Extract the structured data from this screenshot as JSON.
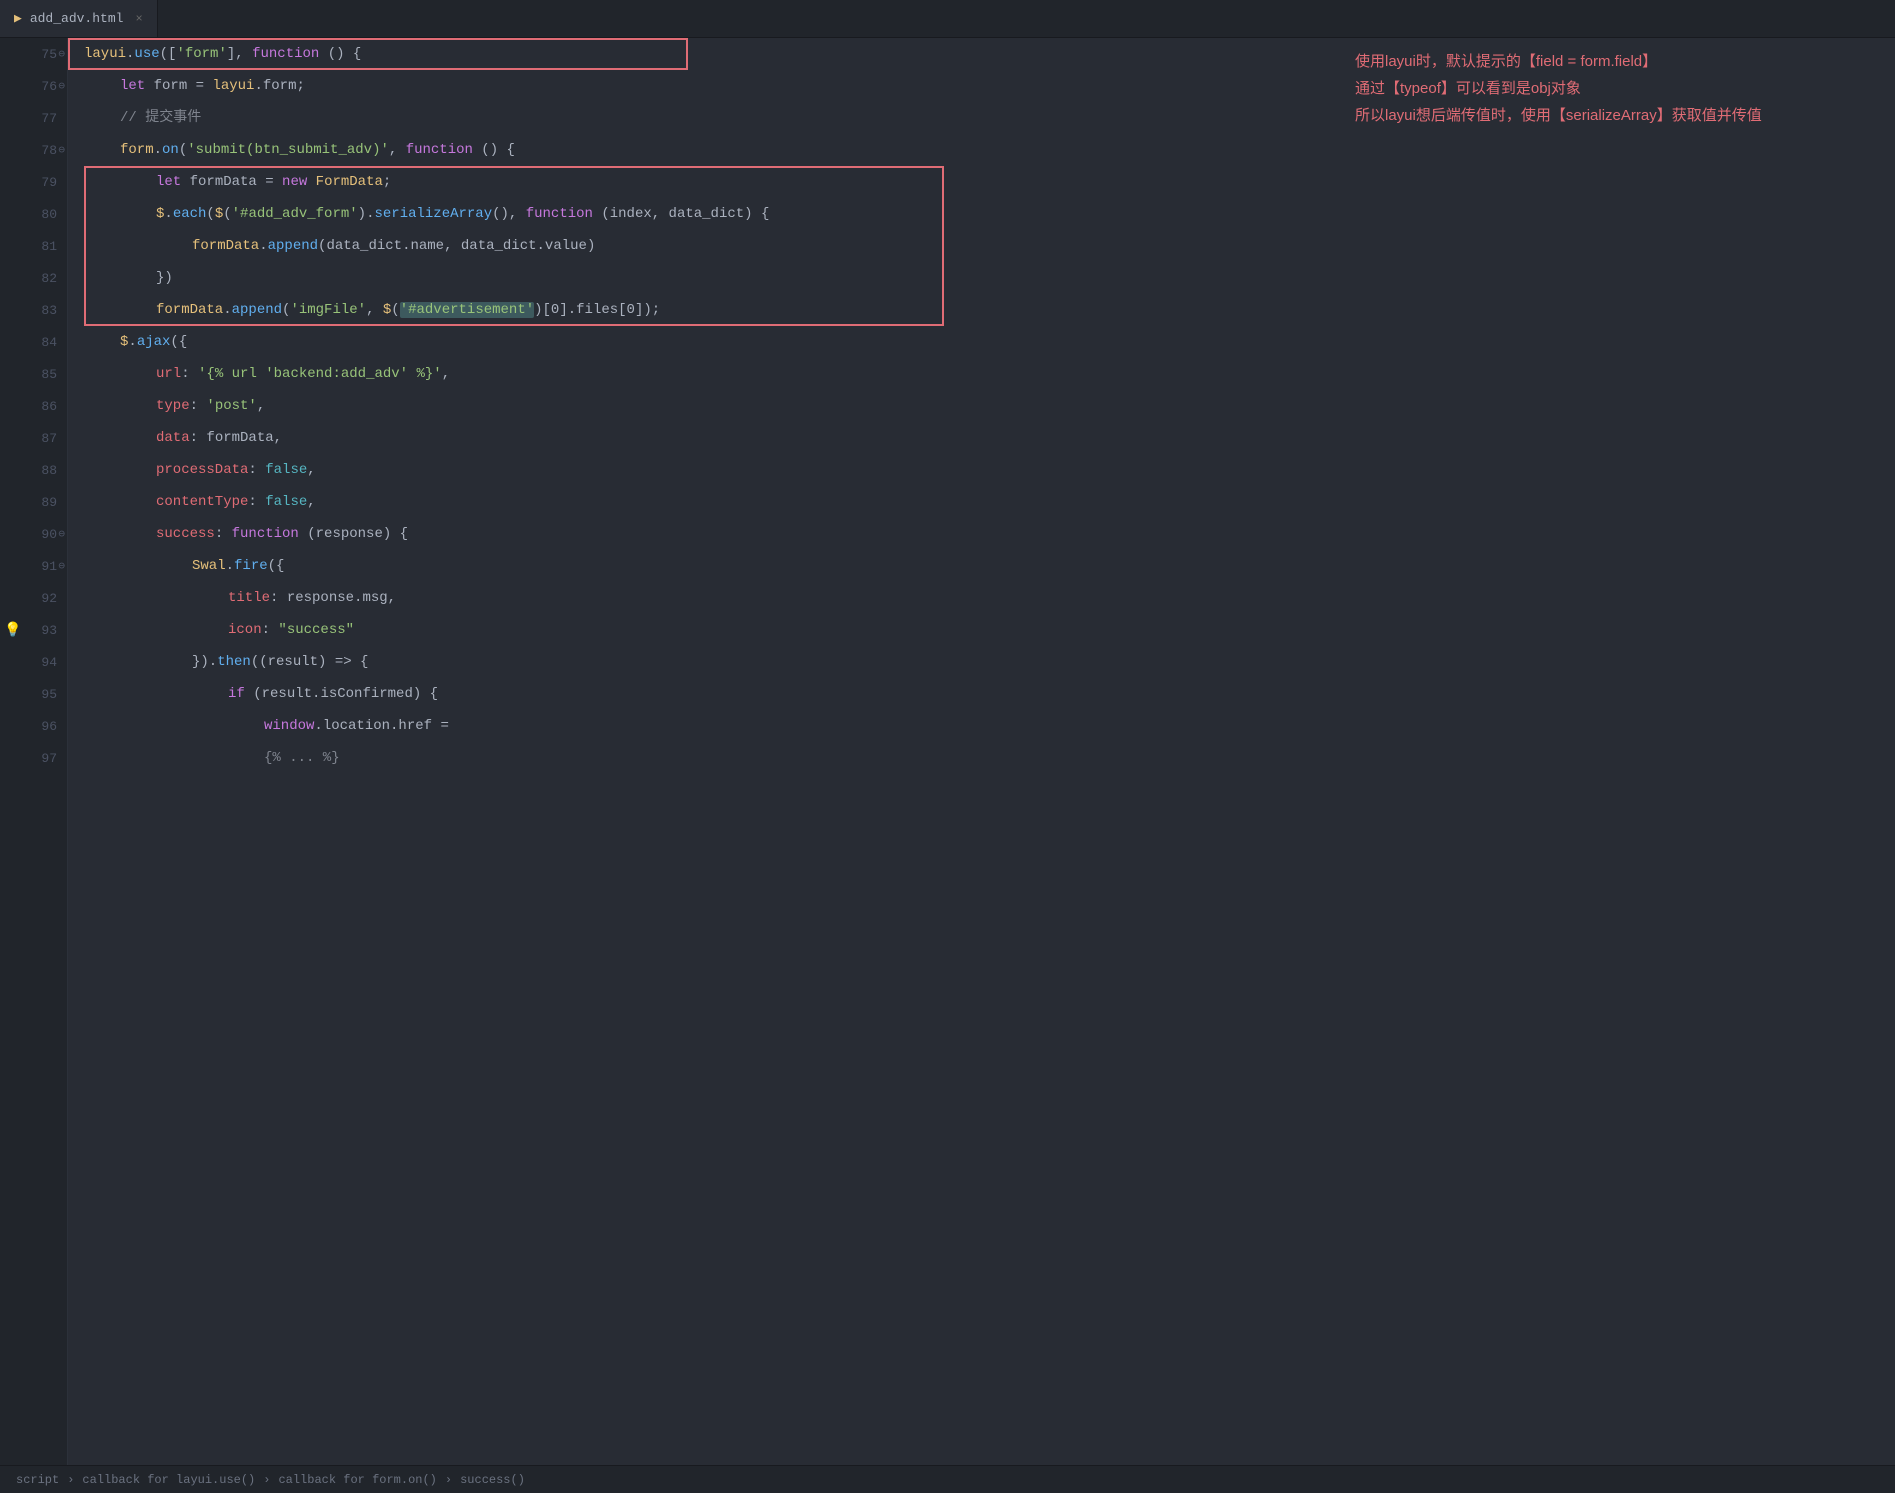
{
  "tab": {
    "icon": "{}",
    "filename": "add_adv.html",
    "close": "×"
  },
  "comment": {
    "line1": "使用layui时，默认提示的【field = form.field】",
    "line2": "通过【typeof】可以看到是obj对象",
    "line3": "所以layui想后端传值时，使用【serializeArray】获取值并传值"
  },
  "lines": [
    {
      "num": "75",
      "indent": 0,
      "tokens": [
        {
          "text": "layui",
          "cls": "kw-yellow"
        },
        {
          "text": ".",
          "cls": "kw-white"
        },
        {
          "text": "use",
          "cls": "kw-blue"
        },
        {
          "text": "([",
          "cls": "kw-white"
        },
        {
          "text": "'form'",
          "cls": "kw-green"
        },
        {
          "text": "], ",
          "cls": "kw-white"
        },
        {
          "text": "function",
          "cls": "kw-purple"
        },
        {
          "text": " () {",
          "cls": "kw-white"
        }
      ],
      "redbox": "outer",
      "hasFold": true
    },
    {
      "num": "76",
      "indent": 1,
      "tokens": [
        {
          "text": "let",
          "cls": "kw-purple"
        },
        {
          "text": " form = ",
          "cls": "kw-white"
        },
        {
          "text": "layui",
          "cls": "kw-yellow"
        },
        {
          "text": ".",
          "cls": "kw-white"
        },
        {
          "text": "form",
          "cls": "kw-white"
        },
        {
          "text": ";",
          "cls": "kw-white"
        }
      ],
      "hasFold": true
    },
    {
      "num": "77",
      "indent": 1,
      "tokens": [
        {
          "text": "// 提交事件",
          "cls": "kw-comment"
        }
      ]
    },
    {
      "num": "78",
      "indent": 1,
      "tokens": [
        {
          "text": "form",
          "cls": "kw-yellow"
        },
        {
          "text": ".",
          "cls": "kw-white"
        },
        {
          "text": "on",
          "cls": "kw-blue"
        },
        {
          "text": "(",
          "cls": "kw-white"
        },
        {
          "text": "'submit(btn_submit_adv)'",
          "cls": "kw-green"
        },
        {
          "text": ", ",
          "cls": "kw-white"
        },
        {
          "text": "function",
          "cls": "kw-purple"
        },
        {
          "text": " () {",
          "cls": "kw-white"
        }
      ],
      "hasFold": true
    },
    {
      "num": "79",
      "indent": 2,
      "tokens": [
        {
          "text": "let",
          "cls": "kw-purple"
        },
        {
          "text": " formData = ",
          "cls": "kw-white"
        },
        {
          "text": "new",
          "cls": "kw-purple"
        },
        {
          "text": " FormData",
          "cls": "kw-yellow"
        },
        {
          "text": ";",
          "cls": "kw-white"
        }
      ],
      "redbox": "inner-start"
    },
    {
      "num": "80",
      "indent": 2,
      "tokens": [
        {
          "text": "$",
          "cls": "kw-yellow"
        },
        {
          "text": ".",
          "cls": "kw-white"
        },
        {
          "text": "each",
          "cls": "kw-blue"
        },
        {
          "text": "(",
          "cls": "kw-white"
        },
        {
          "text": "$",
          "cls": "kw-yellow"
        },
        {
          "text": "(",
          "cls": "kw-white"
        },
        {
          "text": "'#add_adv_form'",
          "cls": "kw-green"
        },
        {
          "text": ").",
          "cls": "kw-white"
        },
        {
          "text": "serializeArray",
          "cls": "kw-blue"
        },
        {
          "text": "(), ",
          "cls": "kw-white"
        },
        {
          "text": "function",
          "cls": "kw-purple"
        },
        {
          "text": " (index, data_dict) {",
          "cls": "kw-white"
        }
      ]
    },
    {
      "num": "81",
      "indent": 3,
      "tokens": [
        {
          "text": "formData",
          "cls": "kw-yellow"
        },
        {
          "text": ".",
          "cls": "kw-white"
        },
        {
          "text": "append",
          "cls": "kw-blue"
        },
        {
          "text": "(",
          "cls": "kw-white"
        },
        {
          "text": "data_dict",
          "cls": "kw-white"
        },
        {
          "text": ".name, ",
          "cls": "kw-white"
        },
        {
          "text": "data_dict",
          "cls": "kw-white"
        },
        {
          "text": ".value",
          "cls": "kw-white"
        },
        {
          "text": ")",
          "cls": "kw-white"
        }
      ]
    },
    {
      "num": "82",
      "indent": 2,
      "tokens": [
        {
          "text": "})",
          "cls": "kw-white"
        }
      ]
    },
    {
      "num": "83",
      "indent": 2,
      "tokens": [
        {
          "text": "formData",
          "cls": "kw-yellow"
        },
        {
          "text": ".",
          "cls": "kw-white"
        },
        {
          "text": "append",
          "cls": "kw-blue"
        },
        {
          "text": "(",
          "cls": "kw-white"
        },
        {
          "text": "'imgFile'",
          "cls": "kw-green"
        },
        {
          "text": ", ",
          "cls": "kw-white"
        },
        {
          "text": "$",
          "cls": "kw-yellow"
        },
        {
          "text": "(",
          "cls": "kw-white"
        },
        {
          "text": "'#advertisement'",
          "cls": "kw-green",
          "highlight": true
        },
        {
          "text": ")[0].",
          "cls": "kw-white"
        },
        {
          "text": "files",
          "cls": "kw-white"
        },
        {
          "text": "[0]",
          "cls": "kw-white"
        },
        {
          "text": ");",
          "cls": "kw-white"
        }
      ],
      "redbox": "inner-end"
    },
    {
      "num": "84",
      "indent": 1,
      "tokens": [
        {
          "text": "$",
          "cls": "kw-yellow"
        },
        {
          "text": ".",
          "cls": "kw-white"
        },
        {
          "text": "ajax",
          "cls": "kw-blue"
        },
        {
          "text": "({",
          "cls": "kw-white"
        }
      ]
    },
    {
      "num": "85",
      "indent": 2,
      "tokens": [
        {
          "text": "url",
          "cls": "kw-red"
        },
        {
          "text": ": ",
          "cls": "kw-white"
        },
        {
          "text": "'{% url ",
          "cls": "kw-green"
        },
        {
          "text": "'backend:add_adv'",
          "cls": "kw-green"
        },
        {
          "text": " %}'",
          "cls": "kw-green"
        },
        {
          "text": ",",
          "cls": "kw-white"
        }
      ]
    },
    {
      "num": "86",
      "indent": 2,
      "tokens": [
        {
          "text": "type",
          "cls": "kw-red"
        },
        {
          "text": ": ",
          "cls": "kw-white"
        },
        {
          "text": "'post'",
          "cls": "kw-green"
        },
        {
          "text": ",",
          "cls": "kw-white"
        }
      ]
    },
    {
      "num": "87",
      "indent": 2,
      "tokens": [
        {
          "text": "data",
          "cls": "kw-red"
        },
        {
          "text": ": formData,",
          "cls": "kw-white"
        }
      ]
    },
    {
      "num": "88",
      "indent": 2,
      "tokens": [
        {
          "text": "processData",
          "cls": "kw-red"
        },
        {
          "text": ": ",
          "cls": "kw-white"
        },
        {
          "text": "false",
          "cls": "kw-cyan"
        },
        {
          "text": ",",
          "cls": "kw-white"
        }
      ]
    },
    {
      "num": "89",
      "indent": 2,
      "tokens": [
        {
          "text": "contentType",
          "cls": "kw-red"
        },
        {
          "text": ": ",
          "cls": "kw-white"
        },
        {
          "text": "false",
          "cls": "kw-cyan"
        },
        {
          "text": ",",
          "cls": "kw-white"
        }
      ]
    },
    {
      "num": "90",
      "indent": 2,
      "tokens": [
        {
          "text": "success",
          "cls": "kw-red"
        },
        {
          "text": ": ",
          "cls": "kw-white"
        },
        {
          "text": "function",
          "cls": "kw-purple"
        },
        {
          "text": " (response) {",
          "cls": "kw-white"
        }
      ],
      "hasFold": true
    },
    {
      "num": "91",
      "indent": 3,
      "tokens": [
        {
          "text": "Swal",
          "cls": "kw-yellow"
        },
        {
          "text": ".",
          "cls": "kw-white"
        },
        {
          "text": "fire",
          "cls": "kw-blue"
        },
        {
          "text": "({",
          "cls": "kw-white"
        }
      ],
      "hasFold": true
    },
    {
      "num": "92",
      "indent": 4,
      "tokens": [
        {
          "text": "title",
          "cls": "kw-red"
        },
        {
          "text": ": response.",
          "cls": "kw-white"
        },
        {
          "text": "msg",
          "cls": "kw-white"
        },
        {
          "text": ",",
          "cls": "kw-white"
        }
      ]
    },
    {
      "num": "93",
      "indent": 4,
      "tokens": [
        {
          "text": "icon",
          "cls": "kw-red"
        },
        {
          "text": ": ",
          "cls": "kw-white"
        },
        {
          "text": "\"success\"",
          "cls": "kw-green"
        }
      ],
      "hasLightbulb": true
    },
    {
      "num": "94",
      "indent": 3,
      "tokens": [
        {
          "text": "}).",
          "cls": "kw-white"
        },
        {
          "text": "then",
          "cls": "kw-blue"
        },
        {
          "text": "((result) => {",
          "cls": "kw-white"
        }
      ]
    },
    {
      "num": "95",
      "indent": 4,
      "tokens": [
        {
          "text": "if",
          "cls": "kw-purple"
        },
        {
          "text": " (result.",
          "cls": "kw-white"
        },
        {
          "text": "isConfirmed",
          "cls": "kw-white"
        },
        {
          "text": ") {",
          "cls": "kw-white"
        }
      ]
    },
    {
      "num": "96",
      "indent": 5,
      "tokens": [
        {
          "text": "window",
          "cls": "kw-purple"
        },
        {
          "text": ".location.href =",
          "cls": "kw-white"
        }
      ]
    },
    {
      "num": "97",
      "indent": 5,
      "tokens": [
        {
          "text": "{% ... %}",
          "cls": "kw-comment"
        }
      ]
    }
  ],
  "statusbar": {
    "items": [
      "script",
      "callback for layui.use()",
      "callback for form.on()",
      "success()"
    ]
  }
}
